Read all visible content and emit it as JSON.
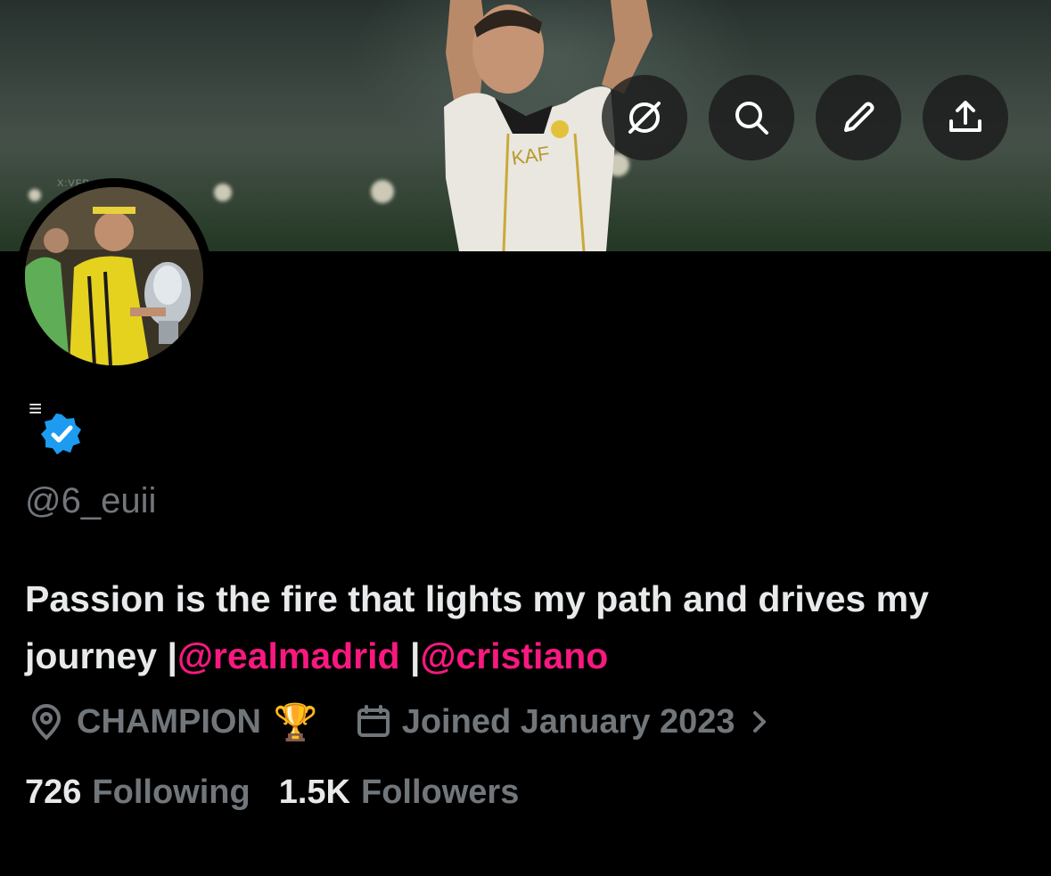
{
  "header": {
    "watermark": "X:VFP",
    "actions": [
      {
        "icon": "grok-icon"
      },
      {
        "icon": "search-icon"
      },
      {
        "icon": "edit-pencil-icon"
      },
      {
        "icon": "share-icon"
      }
    ]
  },
  "profile": {
    "name_glyph": "≡",
    "verified": true,
    "handle": "@6_euii",
    "bio_text_1": "Passion is the fire that lights my path and drives my journey |",
    "bio_mention_1": "@realmadrid",
    "bio_sep": " |",
    "bio_mention_2": "@cristiano",
    "location": "CHAMPION",
    "location_emoji": "🏆",
    "joined": "Joined January 2023",
    "following_count": "726",
    "following_label": "Following",
    "followers_count": "1.5K",
    "followers_label": "Followers"
  },
  "colors": {
    "background": "#000000",
    "primary_text": "#e7e9ea",
    "secondary_text": "#71767b",
    "mention": "#f91880",
    "verified_badge": "#1d9bf0"
  }
}
